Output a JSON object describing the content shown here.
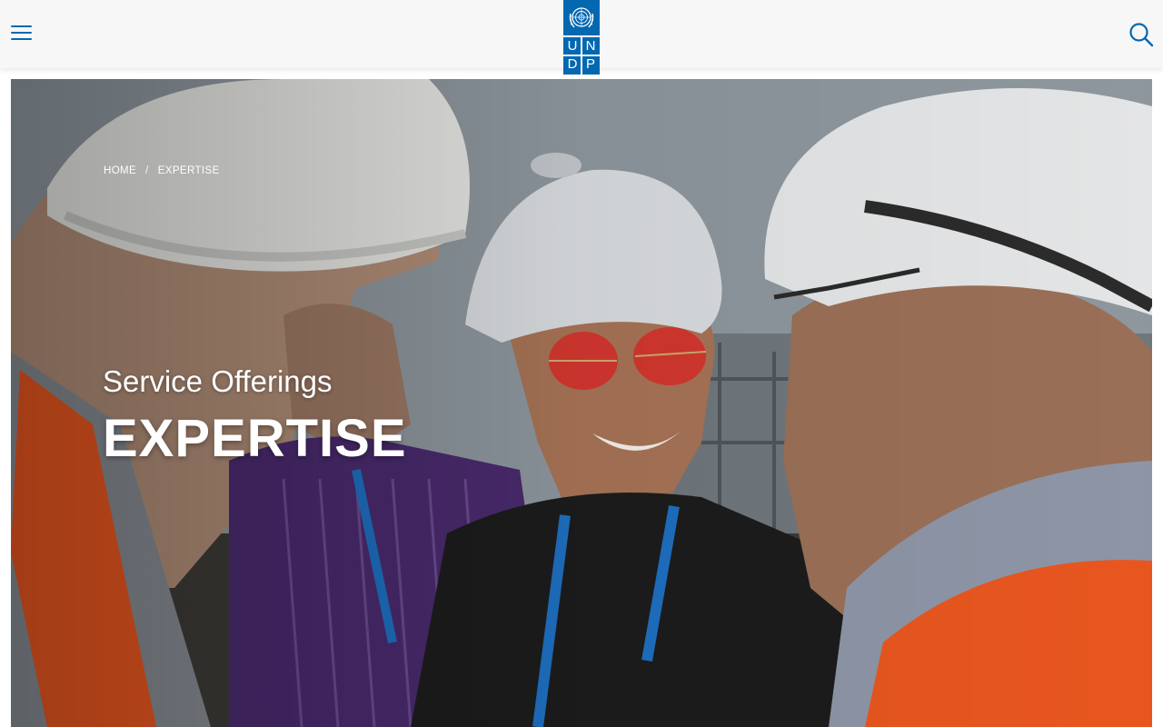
{
  "header": {
    "menu_icon": "hamburger-menu-icon",
    "search_icon": "search-icon",
    "logo": {
      "letters": [
        "U",
        "N",
        "D",
        "P"
      ],
      "emblem": "un-emblem-icon",
      "color": "#0468b1"
    }
  },
  "breadcrumb": {
    "items": [
      "HOME",
      "EXPERTISE"
    ],
    "separator": "/"
  },
  "hero": {
    "eyebrow": "Service Offerings",
    "title": "EXPERTISE"
  },
  "colors": {
    "brand_blue": "#0468b1",
    "header_bg": "#f7f7f7",
    "hero_text": "#ffffff",
    "vest_orange": "#e8561f"
  }
}
